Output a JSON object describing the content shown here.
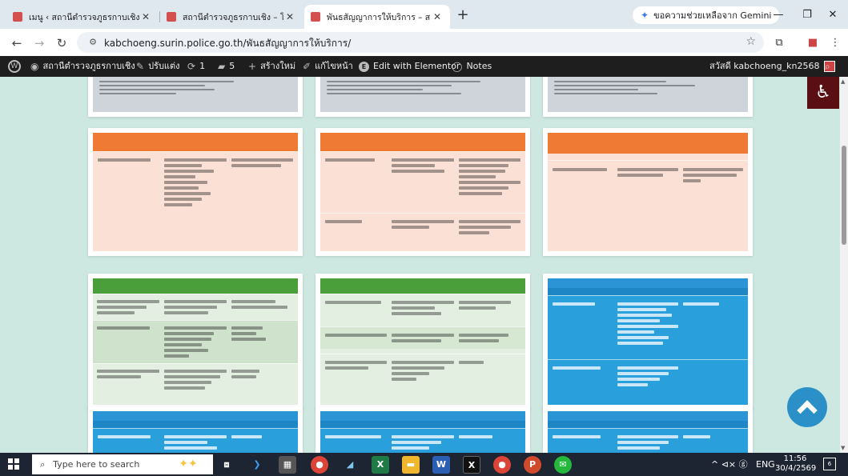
{
  "browser": {
    "tabs": [
      {
        "title": "เมนู ‹ สถานีตำรวจภูธรกาบเชิง — W",
        "active": false
      },
      {
        "title": "สถานีตำรวจภูธรกาบเชิง – โรงพักเพื่อ",
        "active": false
      },
      {
        "title": "พันธสัญญาการให้บริการ – สถานีตำรว",
        "active": true
      }
    ],
    "new_tab_glyph": "+",
    "gemini_label": "ขอความช่วยเหลือจาก Gemini",
    "url": "kabchoeng.surin.police.go.th/พันธสัญญาการให้บริการ/",
    "window_controls": [
      "—",
      "❐",
      "✕"
    ]
  },
  "wp_admin_bar": {
    "site_name": "สถานีตำรวจภูธรกาบเชิง",
    "customize": "ปรับแต่ง",
    "updates_count": "1",
    "comments_count": "5",
    "new_label": "สร้างใหม่",
    "edit_label": "แก้ไขหน้า",
    "elementor_label": "Edit with Elementor",
    "notes_label": "Notes",
    "greeting": "สวัสดี kabchoeng_kn2568"
  },
  "colors": {
    "page_bg": "#cde8e1",
    "orange": "#ef7a34",
    "orange_body": "#fbe0d6",
    "green": "#4a9f3a",
    "green_body": "#e3efe0",
    "blue": "#2b94d4",
    "blue_body": "#29a0dc",
    "gray_body": "#cfd4da"
  },
  "taskbar": {
    "search_placeholder": "Type here to search",
    "apps": [
      "task-view",
      "vscode",
      "calculator",
      "chrome",
      "folder-app",
      "excel",
      "file-explorer",
      "word",
      "x-app",
      "chrome-profile",
      "powerpoint",
      "line"
    ],
    "tray_lang": "ENG",
    "tray_icons": "^ ⊲× ⓖ",
    "time": "11:56",
    "date": "30/4/2569",
    "notif_count": "6"
  }
}
